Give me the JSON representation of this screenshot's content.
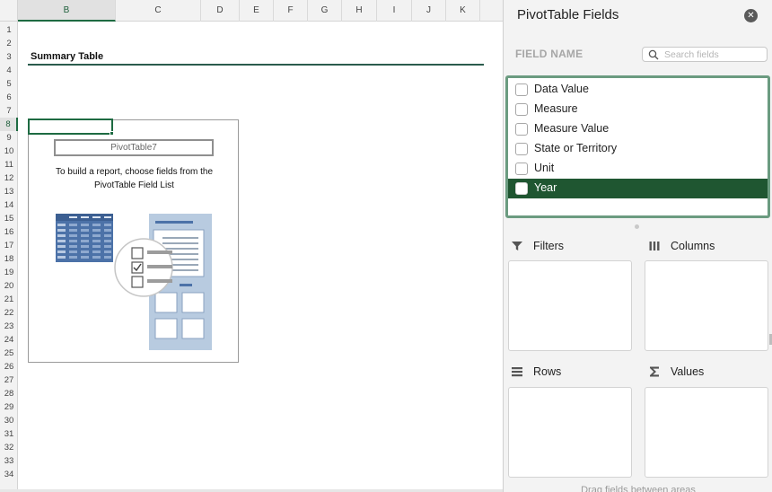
{
  "sheet": {
    "columns": [
      "B",
      "C",
      "D",
      "E",
      "F",
      "G",
      "H",
      "I",
      "J",
      "K"
    ],
    "rows": [
      "1",
      "2",
      "3",
      "4",
      "5",
      "6",
      "7",
      "8",
      "9",
      "10",
      "11",
      "12",
      "13",
      "14",
      "15",
      "16",
      "17",
      "18",
      "19",
      "20",
      "21",
      "22",
      "23",
      "24",
      "25",
      "26",
      "27",
      "28",
      "29",
      "30",
      "31",
      "32",
      "33",
      "34"
    ],
    "active_column": "B",
    "active_row": "8",
    "summary_title": "Summary Table",
    "pivot_placeholder": {
      "name": "PivotTable7",
      "instruction": "To build a report, choose fields from the PivotTable Field List"
    }
  },
  "pane": {
    "title": "PivotTable Fields",
    "field_name_label": "FIELD NAME",
    "search_placeholder": "Search fields",
    "fields": [
      {
        "label": "Data Value",
        "checked": false,
        "selected": false
      },
      {
        "label": "Measure",
        "checked": false,
        "selected": false
      },
      {
        "label": "Measure Value",
        "checked": false,
        "selected": false
      },
      {
        "label": "State or Territory",
        "checked": false,
        "selected": false
      },
      {
        "label": "Unit",
        "checked": false,
        "selected": false
      },
      {
        "label": "Year",
        "checked": false,
        "selected": true
      }
    ],
    "areas": {
      "filters": "Filters",
      "columns": "Columns",
      "rows": "Rows",
      "values": "Values"
    },
    "drag_hint": "Drag fields between areas"
  },
  "colors": {
    "accent": "#1e6b42",
    "selected_row": "#1f5631",
    "field_list_border": "#6b9b80",
    "title_rule": "#2b5c4d"
  }
}
